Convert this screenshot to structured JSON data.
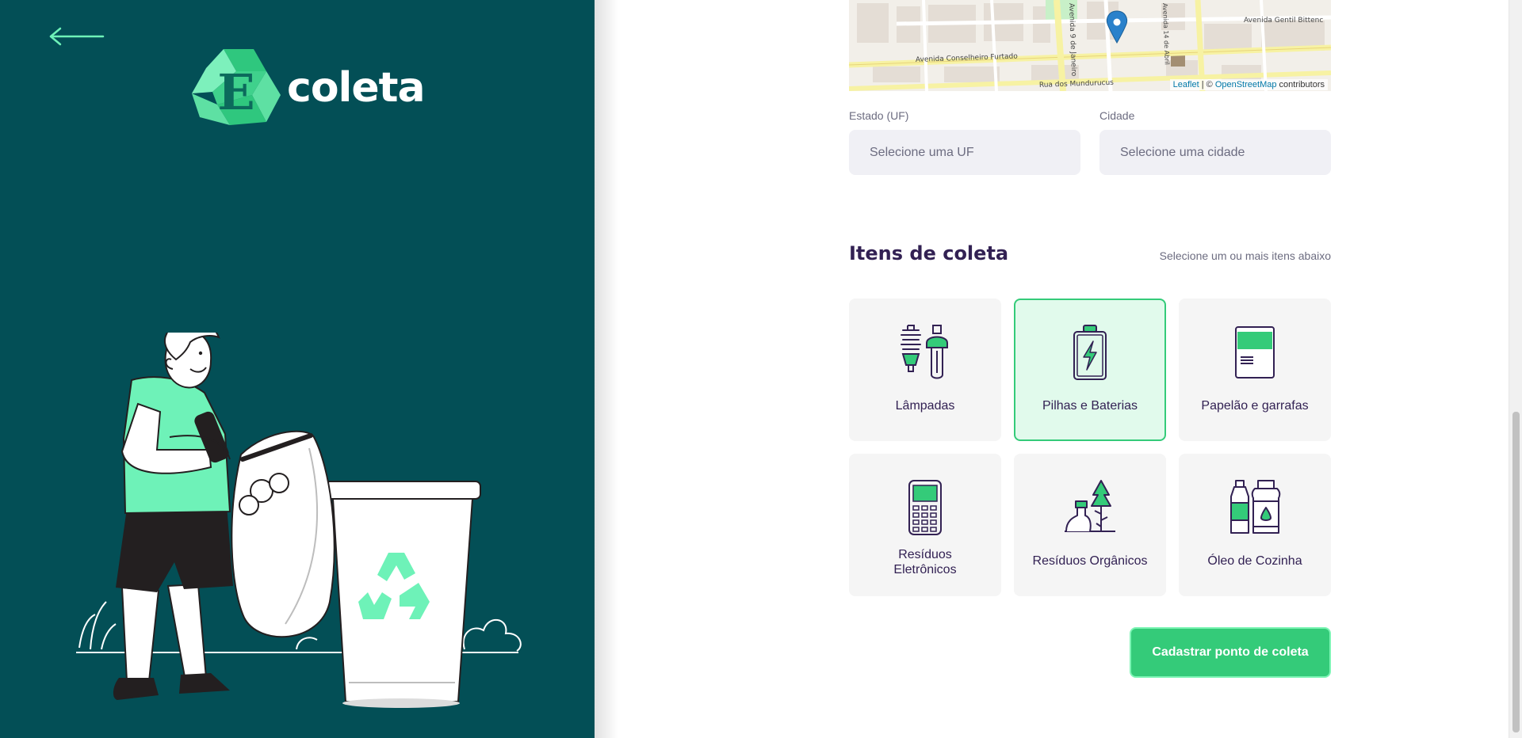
{
  "brand": {
    "name": "coleta",
    "logo_letter": "E"
  },
  "map": {
    "attribution_leaflet": "Leaflet",
    "attribution_separator": " | © ",
    "attribution_osm": "OpenStreetMap",
    "attribution_suffix": " contributors",
    "street_labels": [
      "Avenida Conselheiro Furtado",
      "Rua dos Mundurucus",
      "Avenida Gentil Bittenc",
      "Avenida 9 de Janeiro",
      "Avenida 14 de Abril"
    ]
  },
  "fields": {
    "uf": {
      "label": "Estado (UF)",
      "value": "Selecione uma UF"
    },
    "city": {
      "label": "Cidade",
      "value": "Selecione uma cidade"
    }
  },
  "items_section": {
    "title": "Itens de coleta",
    "hint": "Selecione um ou mais itens abaixo",
    "items": [
      {
        "label": "Lâmpadas",
        "icon": "lamp-icon",
        "selected": false
      },
      {
        "label": "Pilhas e Baterias",
        "icon": "battery-icon",
        "selected": true
      },
      {
        "label": "Papelão e garrafas",
        "icon": "paper-icon",
        "selected": false
      },
      {
        "label": "Resíduos Eletrônicos",
        "icon": "electronics-icon",
        "selected": false
      },
      {
        "label": "Resíduos Orgânicos",
        "icon": "organic-icon",
        "selected": false
      },
      {
        "label": "Óleo de Cozinha",
        "icon": "oil-icon",
        "selected": false
      }
    ]
  },
  "submit_label": "Cadastrar ponto de coleta",
  "colors": {
    "panel_bg": "#034f56",
    "accent": "#34cb79",
    "accent_light": "#6ef2b8",
    "title": "#322153",
    "text_muted": "#6c6c80",
    "card_bg": "#f5f5f5",
    "card_selected_bg": "#e1faec"
  }
}
